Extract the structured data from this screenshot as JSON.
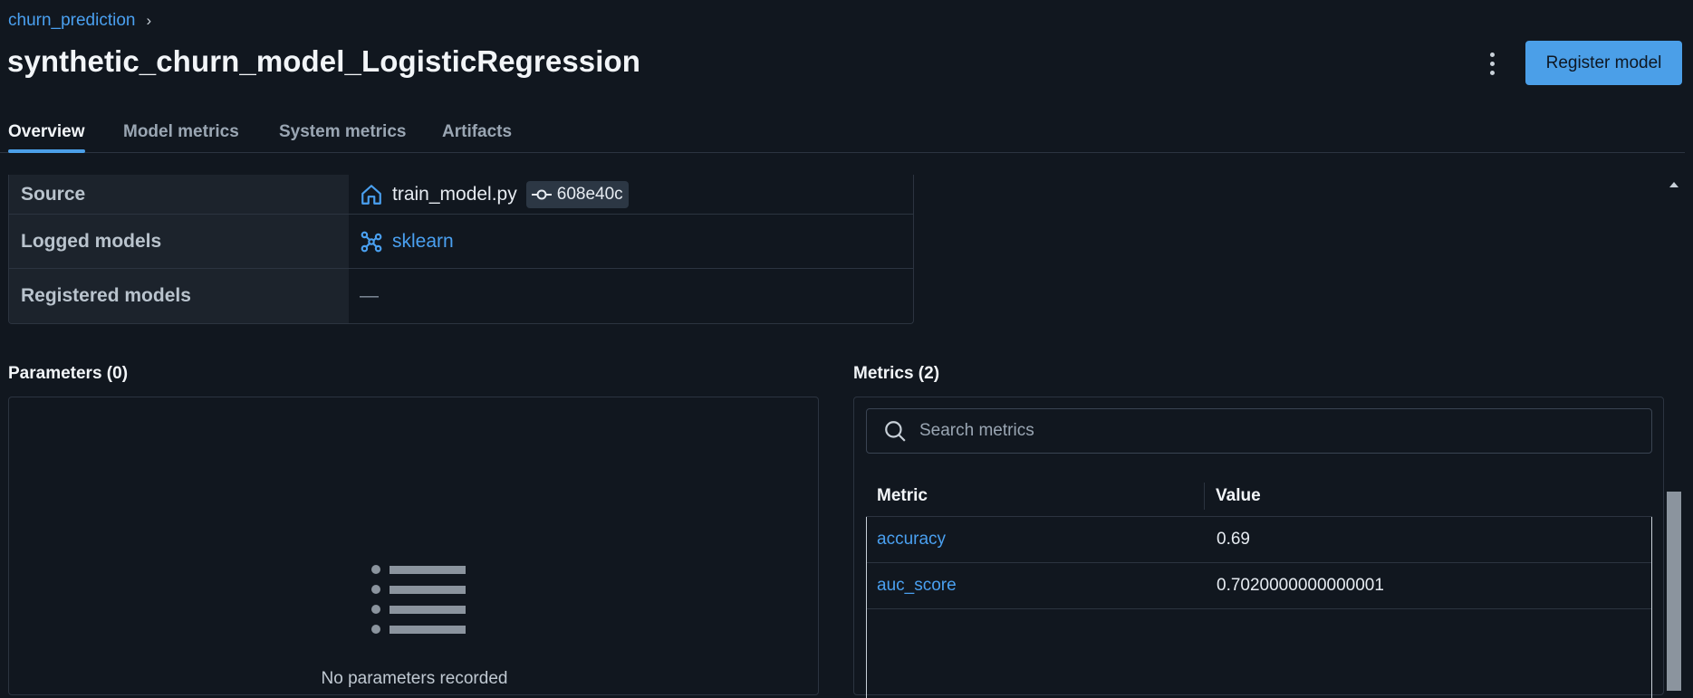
{
  "breadcrumb": {
    "experiment": "churn_prediction",
    "separator": "›"
  },
  "header": {
    "title": "synthetic_churn_model_LogisticRegression",
    "register_label": "Register model"
  },
  "tabs": [
    {
      "label": "Overview",
      "active": true
    },
    {
      "label": "Model metrics",
      "active": false
    },
    {
      "label": "System metrics",
      "active": false
    },
    {
      "label": "Artifacts",
      "active": false
    }
  ],
  "details": {
    "source": {
      "label": "Source",
      "file": "train_model.py",
      "commit": "608e40c"
    },
    "logged_models": {
      "label": "Logged models",
      "value": "sklearn"
    },
    "registered_models": {
      "label": "Registered models",
      "value": "—"
    }
  },
  "parameters": {
    "title": "Parameters (0)",
    "empty_text": "No parameters recorded"
  },
  "metrics": {
    "title": "Metrics (2)",
    "search_placeholder": "Search metrics",
    "columns": [
      "Metric",
      "Value"
    ],
    "rows": [
      {
        "name": "accuracy",
        "value": "0.69"
      },
      {
        "name": "auc_score",
        "value": "0.7020000000000001"
      }
    ]
  },
  "colors": {
    "accent": "#4b9fe8",
    "link": "#4aa0f0",
    "background": "#11171f"
  }
}
